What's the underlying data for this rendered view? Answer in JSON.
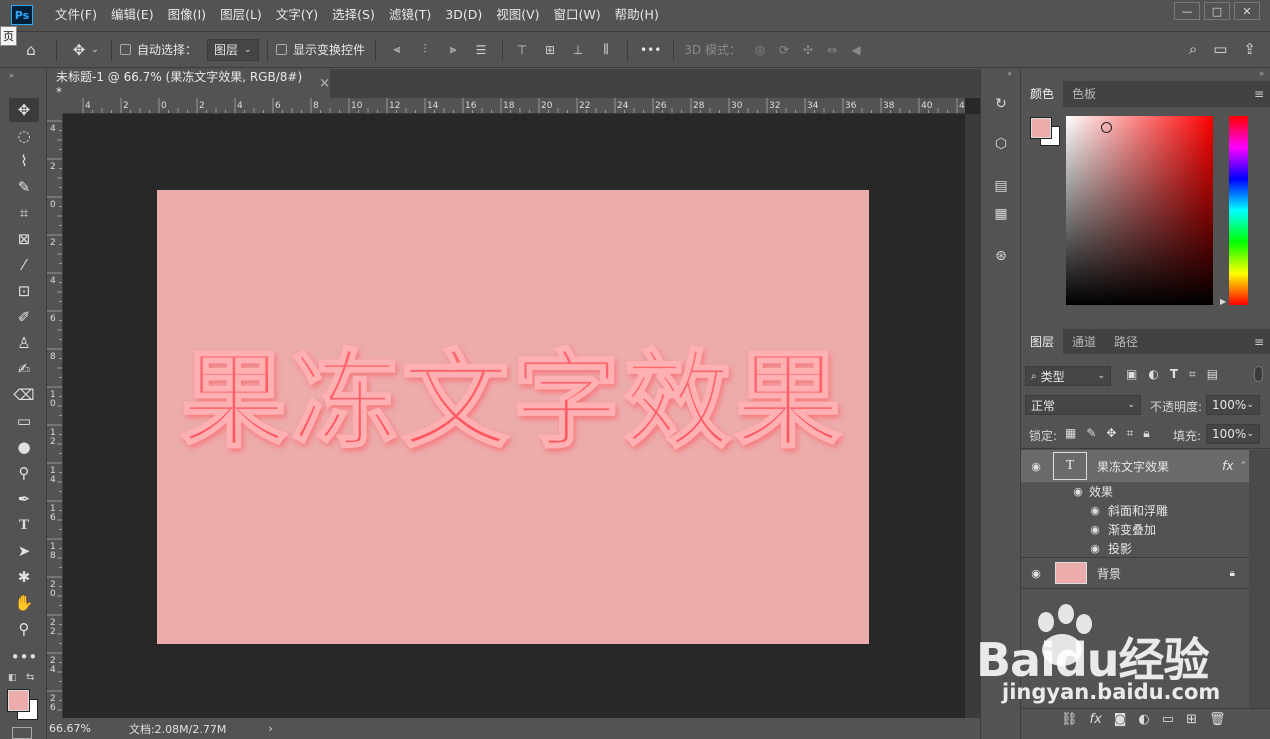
{
  "app": {
    "logo": "Ps",
    "tooltip": "页"
  },
  "menu": [
    "文件(F)",
    "编辑(E)",
    "图像(I)",
    "图层(L)",
    "文字(Y)",
    "选择(S)",
    "滤镜(T)",
    "3D(D)",
    "视图(V)",
    "窗口(W)",
    "帮助(H)"
  ],
  "window_controls": [
    "—",
    "□",
    "✕"
  ],
  "options": {
    "auto_select_label": "自动选择：",
    "auto_select_value": "图层",
    "show_transform_label": "显示变换控件",
    "more": "•••",
    "mode_3d_label": "3D 模式："
  },
  "document": {
    "tab_title": "未标题-1 @ 66.7% (果冻文字效果, RGB/8#) *",
    "tab_close": "×",
    "canvas_text": "果冻文字效果",
    "canvas_color": "#ecacab",
    "text_color": "#ff5a60"
  },
  "ruler_top_labels": [
    "4",
    "2",
    "0",
    "2",
    "4",
    "6",
    "8",
    "10",
    "12",
    "14",
    "16",
    "18",
    "20",
    "22",
    "24",
    "26",
    "28",
    "30",
    "32",
    "34",
    "36",
    "38",
    "40",
    "42"
  ],
  "ruler_left_labels": [
    "4",
    "2",
    "0",
    "2",
    "4",
    "6",
    "8",
    "10",
    "12",
    "14",
    "16",
    "18",
    "20",
    "22",
    "24",
    "26",
    "28"
  ],
  "status": {
    "zoom": "66.67%",
    "doc_info": "文档:2.08M/2.77M",
    "arrow": "›"
  },
  "color_panel": {
    "tabs": [
      "颜色",
      "色板"
    ],
    "foreground": "#ecacab",
    "background": "#ffffff"
  },
  "layers_panel": {
    "tabs": [
      "图层",
      "通道",
      "路径"
    ],
    "filter_kind": "类型",
    "blend_mode": "正常",
    "opacity_label": "不透明度:",
    "opacity_value": "100%",
    "lock_label": "锁定:",
    "fill_label": "填充:",
    "fill_value": "100%",
    "layers": [
      {
        "name": "果冻文字效果",
        "type": "text",
        "fx": "fx"
      },
      {
        "name": "效果"
      },
      {
        "name": "斜面和浮雕"
      },
      {
        "name": "渐变叠加"
      },
      {
        "name": "投影"
      },
      {
        "name": "背景",
        "type": "image"
      }
    ],
    "bottom_icons": [
      "link-icon",
      "fx-icon",
      "mask-icon",
      "adjustment-icon",
      "folder-icon",
      "new-layer-icon",
      "trash-icon"
    ]
  },
  "watermark": {
    "brand": "Baidu经验",
    "url": "jingyan.baidu.com"
  }
}
